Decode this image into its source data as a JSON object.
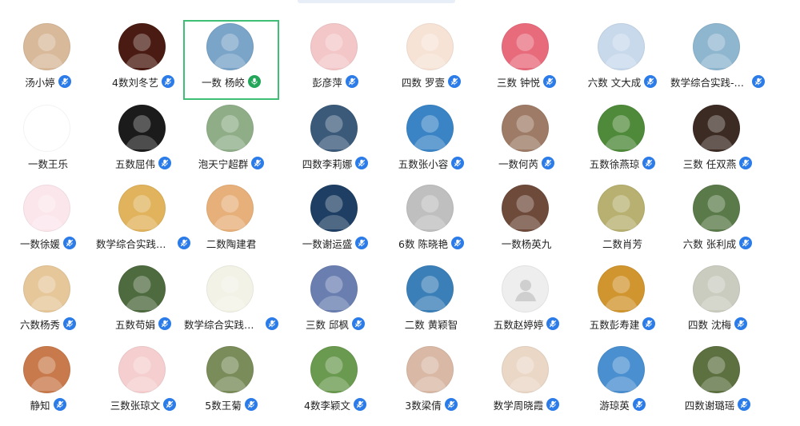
{
  "participants": [
    {
      "name": "汤小婷",
      "mic": true,
      "avatar": "tiger-avatar-icon",
      "color": "#d8b99a"
    },
    {
      "name": "4数刘冬艺",
      "mic": true,
      "avatar": "lantern-photo-avatar",
      "color": "#4a1b12"
    },
    {
      "name": "一数 杨皎",
      "mic": true,
      "avatar": "willow-photo-avatar",
      "color": "#7aa4c8",
      "selected": true,
      "speaking": true
    },
    {
      "name": "彭彦萍",
      "mic": true,
      "avatar": "cartoon-girl-avatar",
      "color": "#f3c7c8"
    },
    {
      "name": "四数 罗壹",
      "mic": true,
      "avatar": "cartoon-girl-avatar",
      "color": "#f7e3d6"
    },
    {
      "name": "三数 钟悦",
      "mic": true,
      "avatar": "flower-avatar",
      "color": "#e86b7c"
    },
    {
      "name": "六数 文大成",
      "mic": true,
      "avatar": "child-photo-avatar",
      "color": "#c8d9ec"
    },
    {
      "name": "数学综合实践-龙...",
      "mic": true,
      "avatar": "lakeside-photo-avatar",
      "color": "#8fb6cf"
    },
    {
      "name": "一数王乐",
      "mic": false,
      "avatar": "cartoon-boy-avatar",
      "color": "#ffffff"
    },
    {
      "name": "五数屈伟",
      "mic": true,
      "avatar": "gorilla-avatar",
      "color": "#1b1b1b"
    },
    {
      "name": "泡天宁超群",
      "mic": true,
      "avatar": "old-man-photo-avatar",
      "color": "#8fae88"
    },
    {
      "name": "四数李莉娜",
      "mic": true,
      "avatar": "window-sky-photo-avatar",
      "color": "#3b5a7a"
    },
    {
      "name": "五数张小容",
      "mic": true,
      "avatar": "sea-photo-avatar",
      "color": "#3a84c6"
    },
    {
      "name": "一数何芮",
      "mic": true,
      "avatar": "woman-photo-avatar",
      "color": "#9d7b66"
    },
    {
      "name": "五数徐燕琼",
      "mic": true,
      "avatar": "grass-photo-avatar",
      "color": "#4f8a3a"
    },
    {
      "name": "三数 任双燕",
      "mic": true,
      "avatar": "sunset-photo-avatar",
      "color": "#3c2b23"
    },
    {
      "name": "一数徐媛",
      "mic": true,
      "avatar": "hearts-bird-avatar",
      "color": "#fbe6ec"
    },
    {
      "name": "数学综合实践刘燕",
      "mic": true,
      "avatar": "desert-photo-avatar",
      "color": "#e0b35c"
    },
    {
      "name": "二数陶建君",
      "mic": false,
      "avatar": "cartoon-pig-avatar",
      "color": "#e7b07a"
    },
    {
      "name": "一数谢运盛",
      "mic": true,
      "avatar": "basketball-player-avatar",
      "color": "#1e3f63"
    },
    {
      "name": "6数 陈晓艳",
      "mic": true,
      "avatar": "willow-bw-avatar",
      "color": "#bfbfbf"
    },
    {
      "name": "一数杨英九",
      "mic": false,
      "avatar": "guitar-photo-avatar",
      "color": "#6e4a3a"
    },
    {
      "name": "二数肖芳",
      "mic": false,
      "avatar": "field-photo-avatar",
      "color": "#b8b070"
    },
    {
      "name": "六数 张利成",
      "mic": true,
      "avatar": "archer-photo-avatar",
      "color": "#5a7a4a"
    },
    {
      "name": "六数杨秀",
      "mic": true,
      "avatar": "tiger-painting-avatar",
      "color": "#e6c79a"
    },
    {
      "name": "五数苟娟",
      "mic": true,
      "avatar": "park-photo-avatar",
      "color": "#4e6a3f"
    },
    {
      "name": "数学综合实践唐...",
      "mic": true,
      "avatar": "cartoon-boy-avatar",
      "color": "#f2f2e6"
    },
    {
      "name": "三数 邱枫",
      "mic": true,
      "avatar": "cartoon-animal-avatar",
      "color": "#6a7fb0"
    },
    {
      "name": "二数 黄颖智",
      "mic": false,
      "avatar": "coast-photo-avatar",
      "color": "#3b7fb8"
    },
    {
      "name": "五数赵婷婷",
      "mic": true,
      "avatar": "default-user-icon",
      "color": "#eeeeee"
    },
    {
      "name": "五数彭寿建",
      "mic": true,
      "avatar": "sunset-hand-avatar",
      "color": "#d0952f"
    },
    {
      "name": "四数 沈梅",
      "mic": true,
      "avatar": "figurine-photo-avatar",
      "color": "#c9ccbf"
    },
    {
      "name": "静知",
      "mic": true,
      "avatar": "red-panda-avatar",
      "color": "#c97a4c"
    },
    {
      "name": "三数张琼文",
      "mic": true,
      "avatar": "cartoon-girl-avatar",
      "color": "#f5cfcf"
    },
    {
      "name": "5数王菊",
      "mic": true,
      "avatar": "woman-garden-avatar",
      "color": "#7a8c5a"
    },
    {
      "name": "4数李颖文",
      "mic": true,
      "avatar": "lotus-photo-avatar",
      "color": "#6a9a4f"
    },
    {
      "name": "3数梁倩",
      "mic": true,
      "avatar": "child-face-avatar",
      "color": "#d9b9a6"
    },
    {
      "name": "数学周晓霞",
      "mic": true,
      "avatar": "baby-photo-avatar",
      "color": "#ead7c6"
    },
    {
      "name": "游琼英",
      "mic": true,
      "avatar": "beach-photo-avatar",
      "color": "#4a8fd0"
    },
    {
      "name": "四数谢璐瑶",
      "mic": true,
      "avatar": "panda-photo-avatar",
      "color": "#5c7040"
    }
  ]
}
